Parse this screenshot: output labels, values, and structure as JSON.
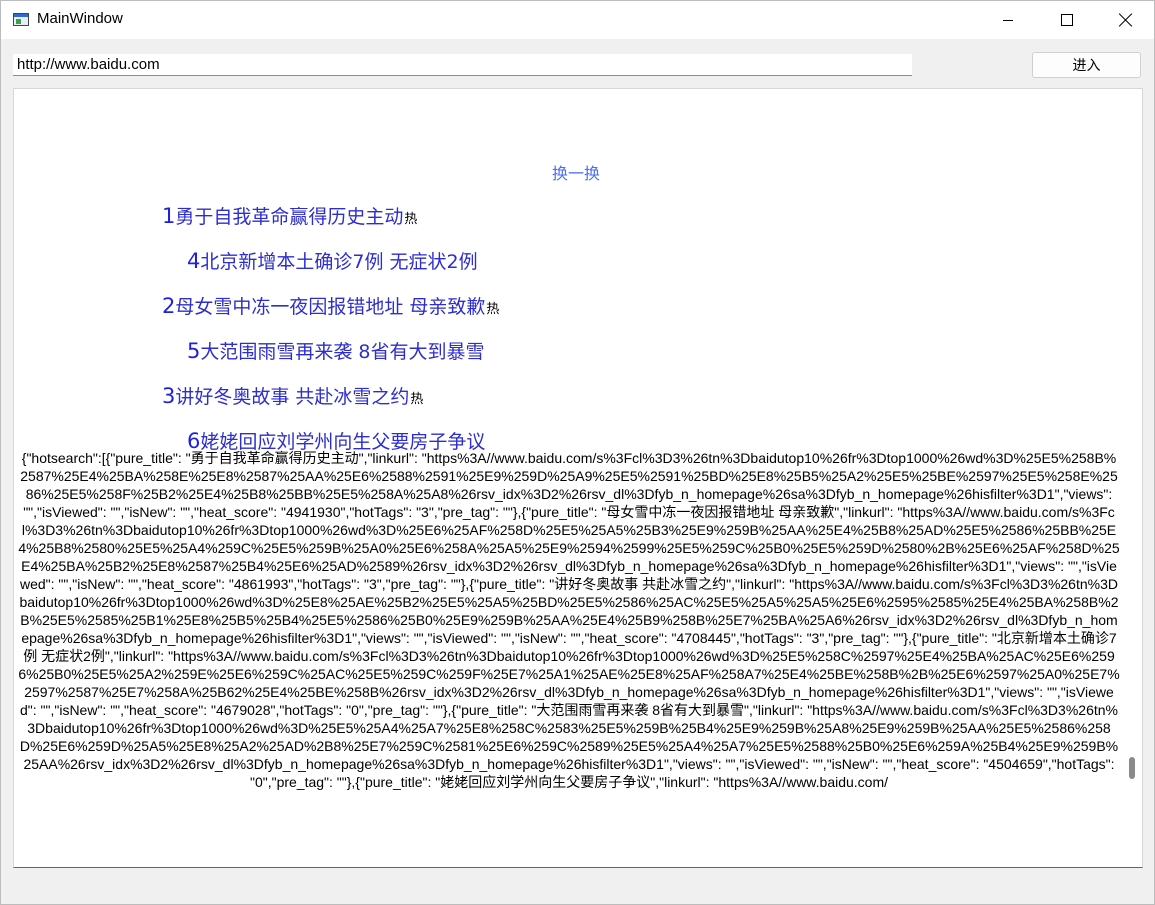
{
  "window": {
    "title": "MainWindow"
  },
  "toolbar": {
    "url_value": "http://www.baidu.com",
    "go_label": "进入"
  },
  "page": {
    "refresh_label": "换一换",
    "hot_items": [
      {
        "num": "1",
        "title": "勇于自我革命赢得历史主动",
        "mark": "热"
      },
      {
        "num": "4",
        "title": "北京新增本土确诊7例 无症状2例",
        "mark": ""
      },
      {
        "num": "2",
        "title": "母女雪中冻一夜因报错地址 母亲致歉",
        "mark": "热"
      },
      {
        "num": "5",
        "title": "大范围雨雪再来袭 8省有大到暴雪",
        "mark": ""
      },
      {
        "num": "3",
        "title": "讲好冬奥故事 共赴冰雪之约",
        "mark": "热"
      },
      {
        "num": "6",
        "title": "姥姥回应刘学州向生父要房子争议",
        "mark": ""
      }
    ],
    "raw_json": "{\"hotsearch\":[{\"pure_title\": \"勇于自我革命赢得历史主动\",\"linkurl\": \"https%3A//www.baidu.com/s%3Fcl%3D3%26tn%3Dbaidutop10%26fr%3Dtop1000%26wd%3D%25E5%258B%2587%25E4%25BA%258E%25E8%2587%25AA%25E6%2588%2591%25E9%259D%25A9%25E5%2591%25BD%25E8%25B5%25A2%25E5%25BE%2597%25E5%258E%2586%25E5%258F%25B2%25E4%25B8%25BB%25E5%258A%25A8%26rsv_idx%3D2%26rsv_dl%3Dfyb_n_homepage%26sa%3Dfyb_n_homepage%26hisfilter%3D1\",\"views\": \"\",\"isViewed\": \"\",\"isNew\": \"\",\"heat_score\": \"4941930\",\"hotTags\": \"3\",\"pre_tag\": \"\"},{\"pure_title\": \"母女雪中冻一夜因报错地址 母亲致歉\",\"linkurl\": \"https%3A//www.baidu.com/s%3Fcl%3D3%26tn%3Dbaidutop10%26fr%3Dtop1000%26wd%3D%25E6%25AF%258D%25E5%25A5%25B3%25E9%259B%25AA%25E4%25B8%25AD%25E5%2586%25BB%25E4%25B8%2580%25E5%25A4%259C%25E5%259B%25A0%25E6%258A%25A5%25E9%2594%2599%25E5%259C%25B0%25E5%259D%2580%2B%25E6%25AF%258D%25E4%25BA%25B2%25E8%2587%25B4%25E6%25AD%2589%26rsv_idx%3D2%26rsv_dl%3Dfyb_n_homepage%26sa%3Dfyb_n_homepage%26hisfilter%3D1\",\"views\": \"\",\"isViewed\": \"\",\"isNew\": \"\",\"heat_score\": \"4861993\",\"hotTags\": \"3\",\"pre_tag\": \"\"},{\"pure_title\": \"讲好冬奥故事 共赴冰雪之约\",\"linkurl\": \"https%3A//www.baidu.com/s%3Fcl%3D3%26tn%3Dbaidutop10%26fr%3Dtop1000%26wd%3D%25E8%25AE%25B2%25E5%25A5%25BD%25E5%2586%25AC%25E5%25A5%25A5%25E6%2595%2585%25E4%25BA%258B%2B%25E5%2585%25B1%25E8%25B5%25B4%25E5%2586%25B0%25E9%259B%25AA%25E4%25B9%258B%25E7%25BA%25A6%26rsv_idx%3D2%26rsv_dl%3Dfyb_n_homepage%26sa%3Dfyb_n_homepage%26hisfilter%3D1\",\"views\": \"\",\"isViewed\": \"\",\"isNew\": \"\",\"heat_score\": \"4708445\",\"hotTags\": \"3\",\"pre_tag\": \"\"},{\"pure_title\": \"北京新增本土确诊7例 无症状2例\",\"linkurl\": \"https%3A//www.baidu.com/s%3Fcl%3D3%26tn%3Dbaidutop10%26fr%3Dtop1000%26wd%3D%25E5%258C%2597%25E4%25BA%25AC%25E6%2596%25B0%25E5%25A2%259E%25E6%259C%25AC%25E5%259C%259F%25E7%25A1%25AE%25E8%25AF%258A7%25E4%25BE%258B%2B%25E6%2597%25A0%25E7%2597%2587%25E7%258A%25B62%25E4%25BE%258B%26rsv_idx%3D2%26rsv_dl%3Dfyb_n_homepage%26sa%3Dfyb_n_homepage%26hisfilter%3D1\",\"views\": \"\",\"isViewed\": \"\",\"isNew\": \"\",\"heat_score\": \"4679028\",\"hotTags\": \"0\",\"pre_tag\": \"\"},{\"pure_title\": \"大范围雨雪再来袭 8省有大到暴雪\",\"linkurl\": \"https%3A//www.baidu.com/s%3Fcl%3D3%26tn%3Dbaidutop10%26fr%3Dtop1000%26wd%3D%25E5%25A4%25A7%25E8%258C%2583%25E5%259B%25B4%25E9%259B%25A8%25E9%259B%25AA%25E5%2586%258D%25E6%259D%25A5%25E8%25A2%25AD%2B8%25E7%259C%2581%25E6%259C%2589%25E5%25A4%25A7%25E5%2588%25B0%25E6%259A%25B4%25E9%259B%25AA%26rsv_idx%3D2%26rsv_dl%3Dfyb_n_homepage%26sa%3Dfyb_n_homepage%26hisfilter%3D1\",\"views\": \"\",\"isViewed\": \"\",\"isNew\": \"\",\"heat_score\": \"4504659\",\"hotTags\": \"0\",\"pre_tag\": \"\"},{\"pure_title\": \"姥姥回应刘学州向生父要房子争议\",\"linkurl\": \"https%3A//www.baidu.com/"
  }
}
